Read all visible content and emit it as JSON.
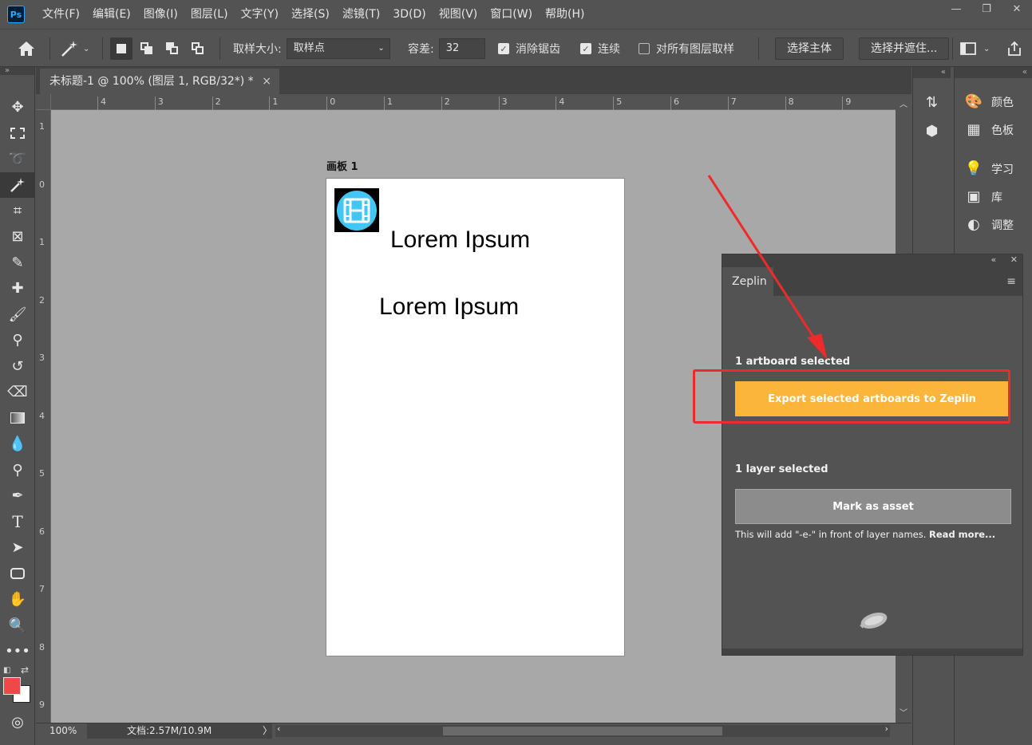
{
  "app": {
    "logo_text": "Ps"
  },
  "menu": [
    "文件(F)",
    "编辑(E)",
    "图像(I)",
    "图层(L)",
    "文字(Y)",
    "选择(S)",
    "滤镜(T)",
    "3D(D)",
    "视图(V)",
    "窗口(W)",
    "帮助(H)"
  ],
  "window_controls": {
    "minimize": "—",
    "restore": "❐",
    "close": "✕"
  },
  "options_bar": {
    "sample_size_label": "取样大小:",
    "sample_size_value": "取样点",
    "tolerance_label": "容差:",
    "tolerance_value": "32",
    "anti_alias_label": "消除锯齿",
    "anti_alias_checked": true,
    "contiguous_label": "连续",
    "contiguous_checked": true,
    "sample_all_layers_label": "对所有图层取样",
    "sample_all_layers_checked": false,
    "select_subject_label": "选择主体",
    "select_and_mask_label": "选择并遮住..."
  },
  "document": {
    "tab_title": "未标题-1 @ 100% (图层 1, RGB/32*) *",
    "close_glyph": "×",
    "artboard_label": "画板 1",
    "text_layers": [
      "Lorem Ipsum",
      "Lorem Ipsum"
    ]
  },
  "rulers": {
    "top": [
      "4",
      "3",
      "2",
      "1",
      "0",
      "1",
      "2",
      "3",
      "4",
      "5",
      "6",
      "7",
      "8",
      "9"
    ],
    "left": [
      "1",
      "0",
      "1",
      "2",
      "3",
      "4",
      "5",
      "6",
      "7",
      "8",
      "9"
    ]
  },
  "status_bar": {
    "zoom": "100%",
    "doc_info": "文档:2.57M/10.9M",
    "arrow": "〉"
  },
  "right_panels": [
    {
      "label": "颜色",
      "icon": "palette-icon"
    },
    {
      "label": "色板",
      "icon": "swatches-icon"
    },
    {
      "label": "学习",
      "icon": "lightbulb-icon"
    },
    {
      "label": "库",
      "icon": "library-icon"
    },
    {
      "label": "调整",
      "icon": "adjustments-icon"
    }
  ],
  "zeplin_panel": {
    "tab_title": "Zeplin",
    "artboards_selected": "1 artboard selected",
    "export_button": "Export selected artboards to Zeplin",
    "layers_selected": "1 layer selected",
    "mark_asset_button": "Mark as asset",
    "note_prefix": "This will add \"-e-\" in front of layer names. ",
    "note_link": "Read more..."
  },
  "colors": {
    "accent_export": "#fbb53b",
    "annotation_red": "#ee2a2a",
    "foreground_swatch": "#f04848",
    "background_swatch": "#ffffff"
  }
}
